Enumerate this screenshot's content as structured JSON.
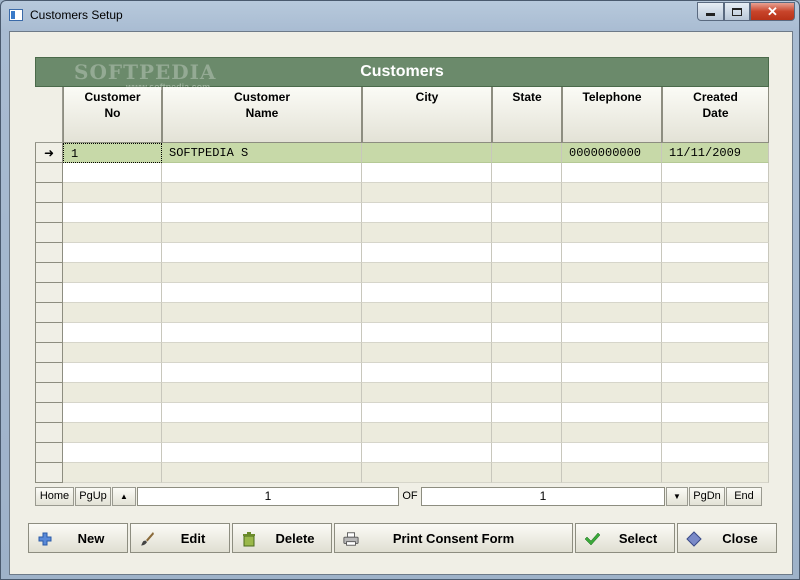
{
  "window": {
    "title": "Customers Setup"
  },
  "grid": {
    "title": "Customers",
    "watermark": "SOFTPEDIA",
    "watermark_sub": "www.softpedia.com",
    "columns": [
      {
        "line1": "Customer",
        "line2": "No"
      },
      {
        "line1": "Customer",
        "line2": "Name"
      },
      {
        "line1": "City",
        "line2": ""
      },
      {
        "line1": "State",
        "line2": ""
      },
      {
        "line1": "Telephone",
        "line2": ""
      },
      {
        "line1": "Created",
        "line2": "Date"
      }
    ],
    "rows": [
      {
        "no": "1",
        "name": "SOFTPEDIA S",
        "city": "",
        "state": "",
        "tel": "0000000000",
        "date": "11/11/2009"
      }
    ],
    "current_row_marker": "➜"
  },
  "nav": {
    "home": "Home",
    "pgup": "PgUp",
    "up": "▲",
    "current": "1",
    "of": "OF",
    "total": "1",
    "down": "▼",
    "pgdn": "PgDn",
    "end": "End"
  },
  "buttons": {
    "new": "New",
    "edit": "Edit",
    "delete": "Delete",
    "print": "Print Consent Form",
    "select": "Select",
    "close": "Close"
  },
  "colors": {
    "header": "#6b8a6b",
    "selected_row": "#c7d9a8",
    "alt_row": "#ecebdd"
  }
}
